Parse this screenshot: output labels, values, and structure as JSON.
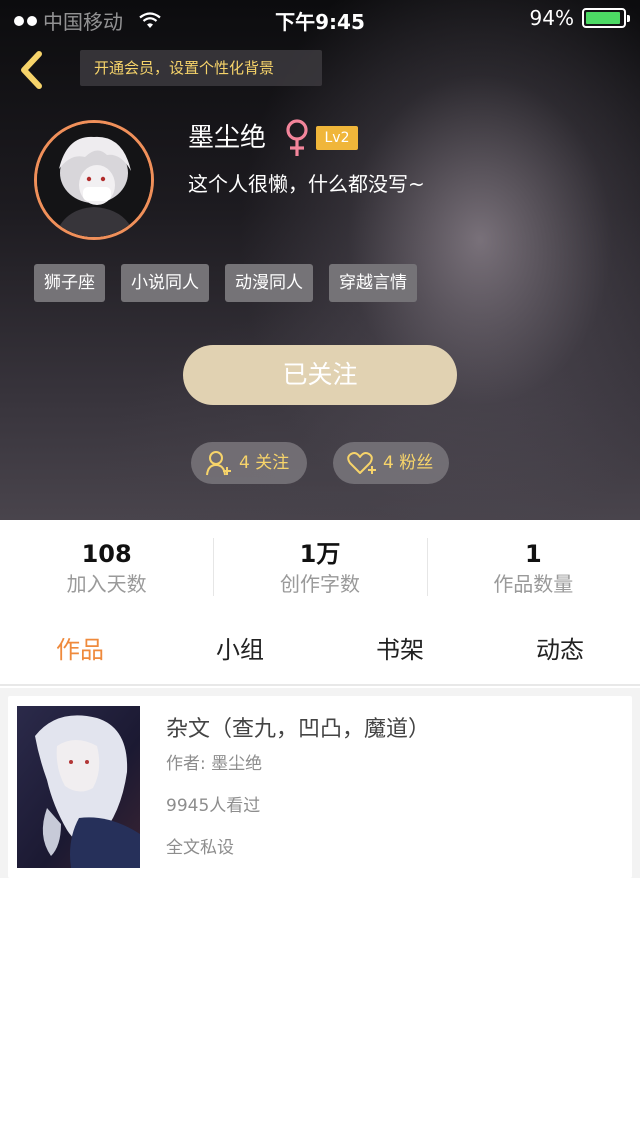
{
  "status_bar": {
    "carrier": "中国移动",
    "time": "下午9:45",
    "battery": "94%",
    "battery_level": 0.94
  },
  "header": {
    "vip_banner": "开通会员，设置个性化背景",
    "username": "墨尘绝",
    "level": "Lv2",
    "bio": "这个人很懒，什么都没写~",
    "tags": [
      "狮子座",
      "小说同人",
      "动漫同人",
      "穿越言情"
    ],
    "follow_button": "已关注",
    "following": "4 关注",
    "fans": "4 粉丝"
  },
  "stats": [
    {
      "value": "108",
      "label": "加入天数"
    },
    {
      "value": "1万",
      "label": "创作字数"
    },
    {
      "value": "1",
      "label": "作品数量"
    }
  ],
  "tabs": [
    "作品",
    "小组",
    "书架",
    "动态"
  ],
  "book": {
    "title": "杂文（查九，凹凸，魔道）",
    "author": "作者: 墨尘绝",
    "views": "9945人看过",
    "note": "全文私设"
  },
  "colors": {
    "accent": "#ef8a3c",
    "gold": "#f6d36a",
    "follow_button": "#e1d2b2",
    "avatar_ring": "#f0905a",
    "level_badge": "#f0b63a",
    "battery": "#4cd964"
  }
}
